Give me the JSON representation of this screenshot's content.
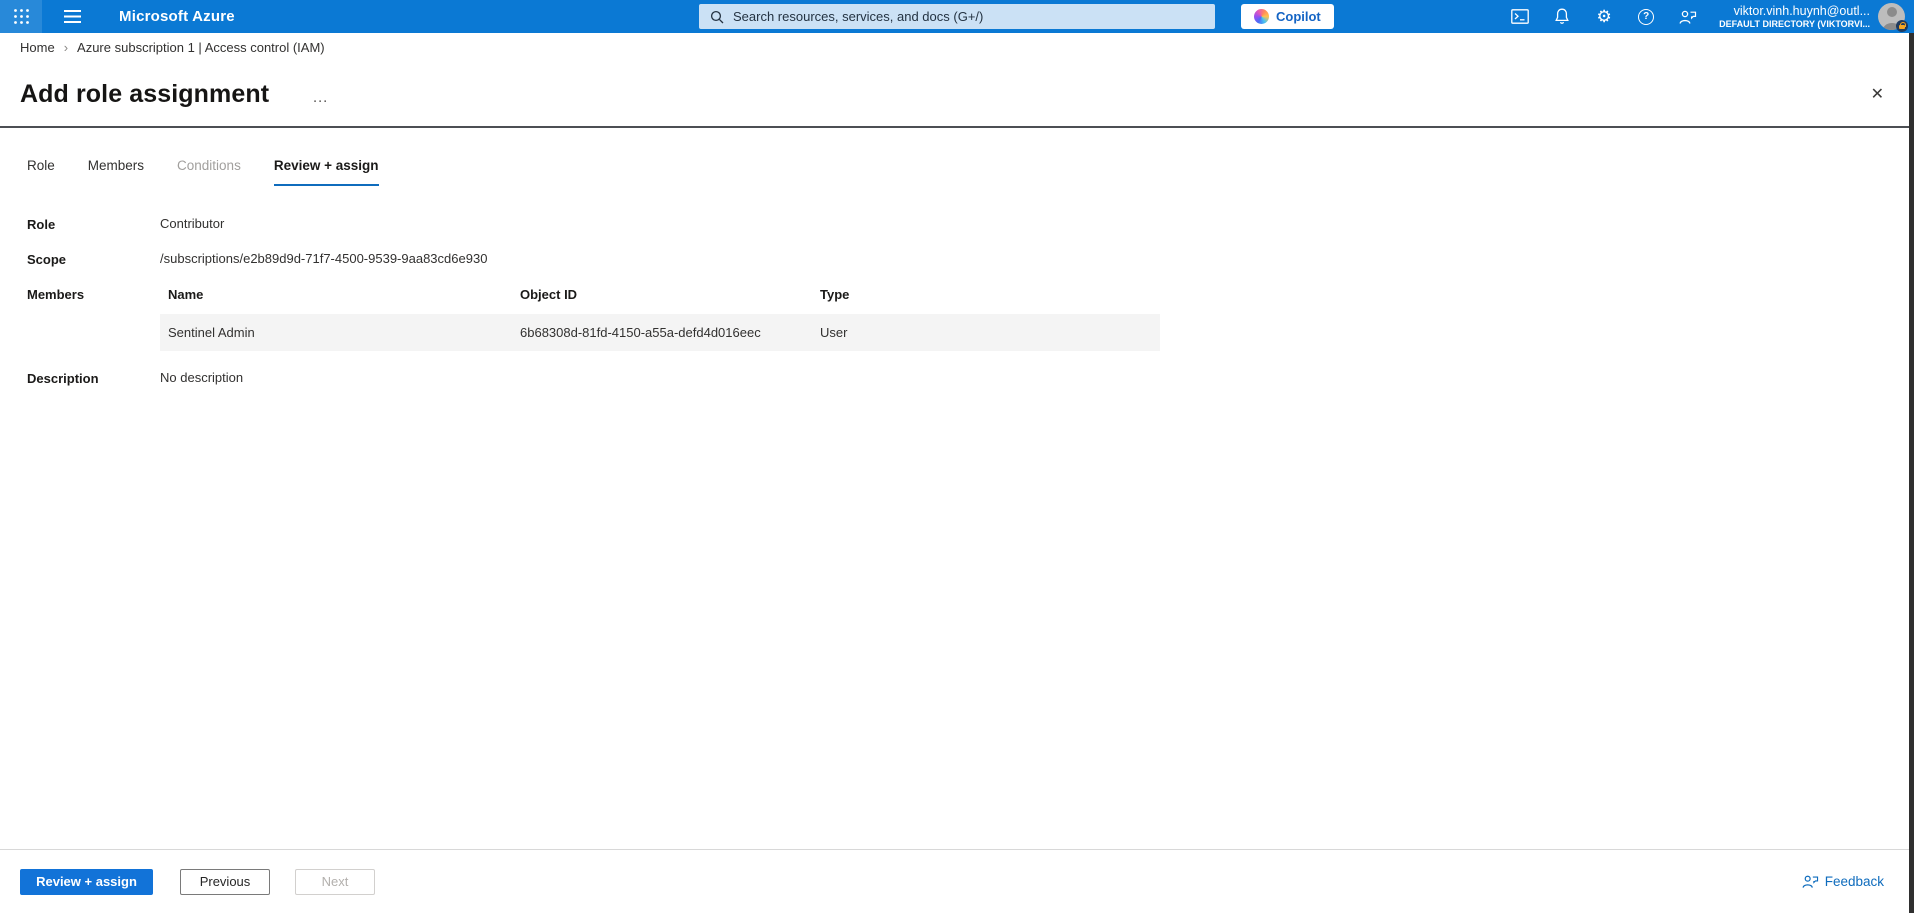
{
  "topbar": {
    "brand": "Microsoft Azure",
    "search": {
      "placeholder": "Search resources, services, and docs (G+/)"
    },
    "copilot_label": "Copilot",
    "icons": [
      "app-launcher-icon",
      "hamburger-icon",
      "search-icon",
      "copilot-icon",
      "cloud-shell-icon",
      "notifications-bell-icon",
      "settings-gear-icon",
      "help-icon",
      "feedback-person-icon",
      "avatar",
      "lock-badge-icon"
    ],
    "help_glyph": "?",
    "gear_glyph": "⚙",
    "user": {
      "email": "viktor.vinh.huynh@outl...",
      "directory": "DEFAULT DIRECTORY (VIKTORVI..."
    }
  },
  "breadcrumb": {
    "home": "Home",
    "separator": "›",
    "current": "Azure subscription 1 | Access control (IAM)"
  },
  "page": {
    "title": "Add role assignment",
    "more_options": "…",
    "close": "✕"
  },
  "tabs": {
    "items": [
      {
        "label": "Role",
        "state": "enabled"
      },
      {
        "label": "Members",
        "state": "enabled"
      },
      {
        "label": "Conditions",
        "state": "disabled"
      },
      {
        "label": "Review + assign",
        "state": "active"
      }
    ]
  },
  "review": {
    "role": {
      "label": "Role",
      "value": "Contributor"
    },
    "scope": {
      "label": "Scope",
      "value": "/subscriptions/e2b89d9d-71f7-4500-9539-9aa83cd6e930"
    },
    "members": {
      "label": "Members",
      "columns": [
        "Name",
        "Object ID",
        "Type"
      ],
      "rows": [
        {
          "name": "Sentinel Admin",
          "object_id": "6b68308d-81fd-4150-a55a-defd4d016eec",
          "type": "User"
        }
      ]
    },
    "description": {
      "label": "Description",
      "value": "No description"
    }
  },
  "footer": {
    "primary": "Review + assign",
    "previous": "Previous",
    "next": "Next",
    "feedback": "Feedback"
  },
  "colors": {
    "topbar_bg": "#0b79d4",
    "search_bg": "#cbe1f5",
    "primary_button": "#1273d8",
    "active_tab_underline": "#0f6cbd",
    "link": "#0f6cbd",
    "disabled_text": "#a19f9d",
    "member_row_bg": "#f4f4f4",
    "title_divider": "#4c4f54",
    "window_edge": "#2f2f2f"
  }
}
